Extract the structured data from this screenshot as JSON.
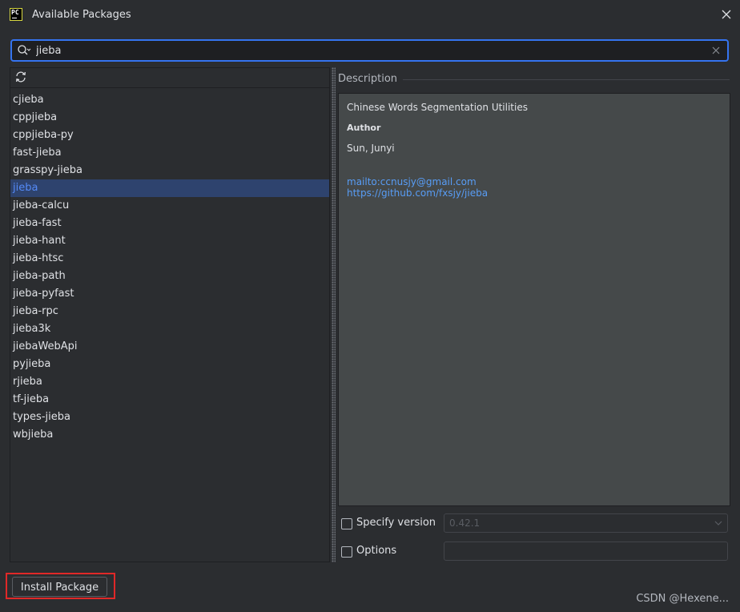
{
  "window": {
    "title": "Available Packages",
    "app_logo_text": "PC"
  },
  "search": {
    "value": "jieba"
  },
  "packages": [
    "cjieba",
    "cppjieba",
    "cppjieba-py",
    "fast-jieba",
    "grasspy-jieba",
    "jieba",
    "jieba-calcu",
    "jieba-fast",
    "jieba-hant",
    "jieba-htsc",
    "jieba-path",
    "jieba-pyfast",
    "jieba-rpc",
    "jieba3k",
    "jiebaWebApi",
    "pyjieba",
    "rjieba",
    "tf-jieba",
    "types-jieba",
    "wbjieba"
  ],
  "selected_package": "jieba",
  "description": {
    "header": "Description",
    "summary": "Chinese Words Segmentation Utilities",
    "author_label": "Author",
    "author": "Sun, Junyi",
    "email_link": "mailto:ccnusjy@gmail.com",
    "repo_link": "https://github.com/fxsjy/jieba"
  },
  "options": {
    "specify_version_label": "Specify version",
    "specify_version_checked": false,
    "version_value": "0.42.1",
    "options_label": "Options",
    "options_checked": false,
    "options_value": ""
  },
  "install_button_label": "Install Package",
  "watermark": "CSDN @Hexene...",
  "colors": {
    "accent": "#3574f0",
    "selection": "#2e436e",
    "link": "#589df6",
    "highlight_box": "#e02828"
  }
}
